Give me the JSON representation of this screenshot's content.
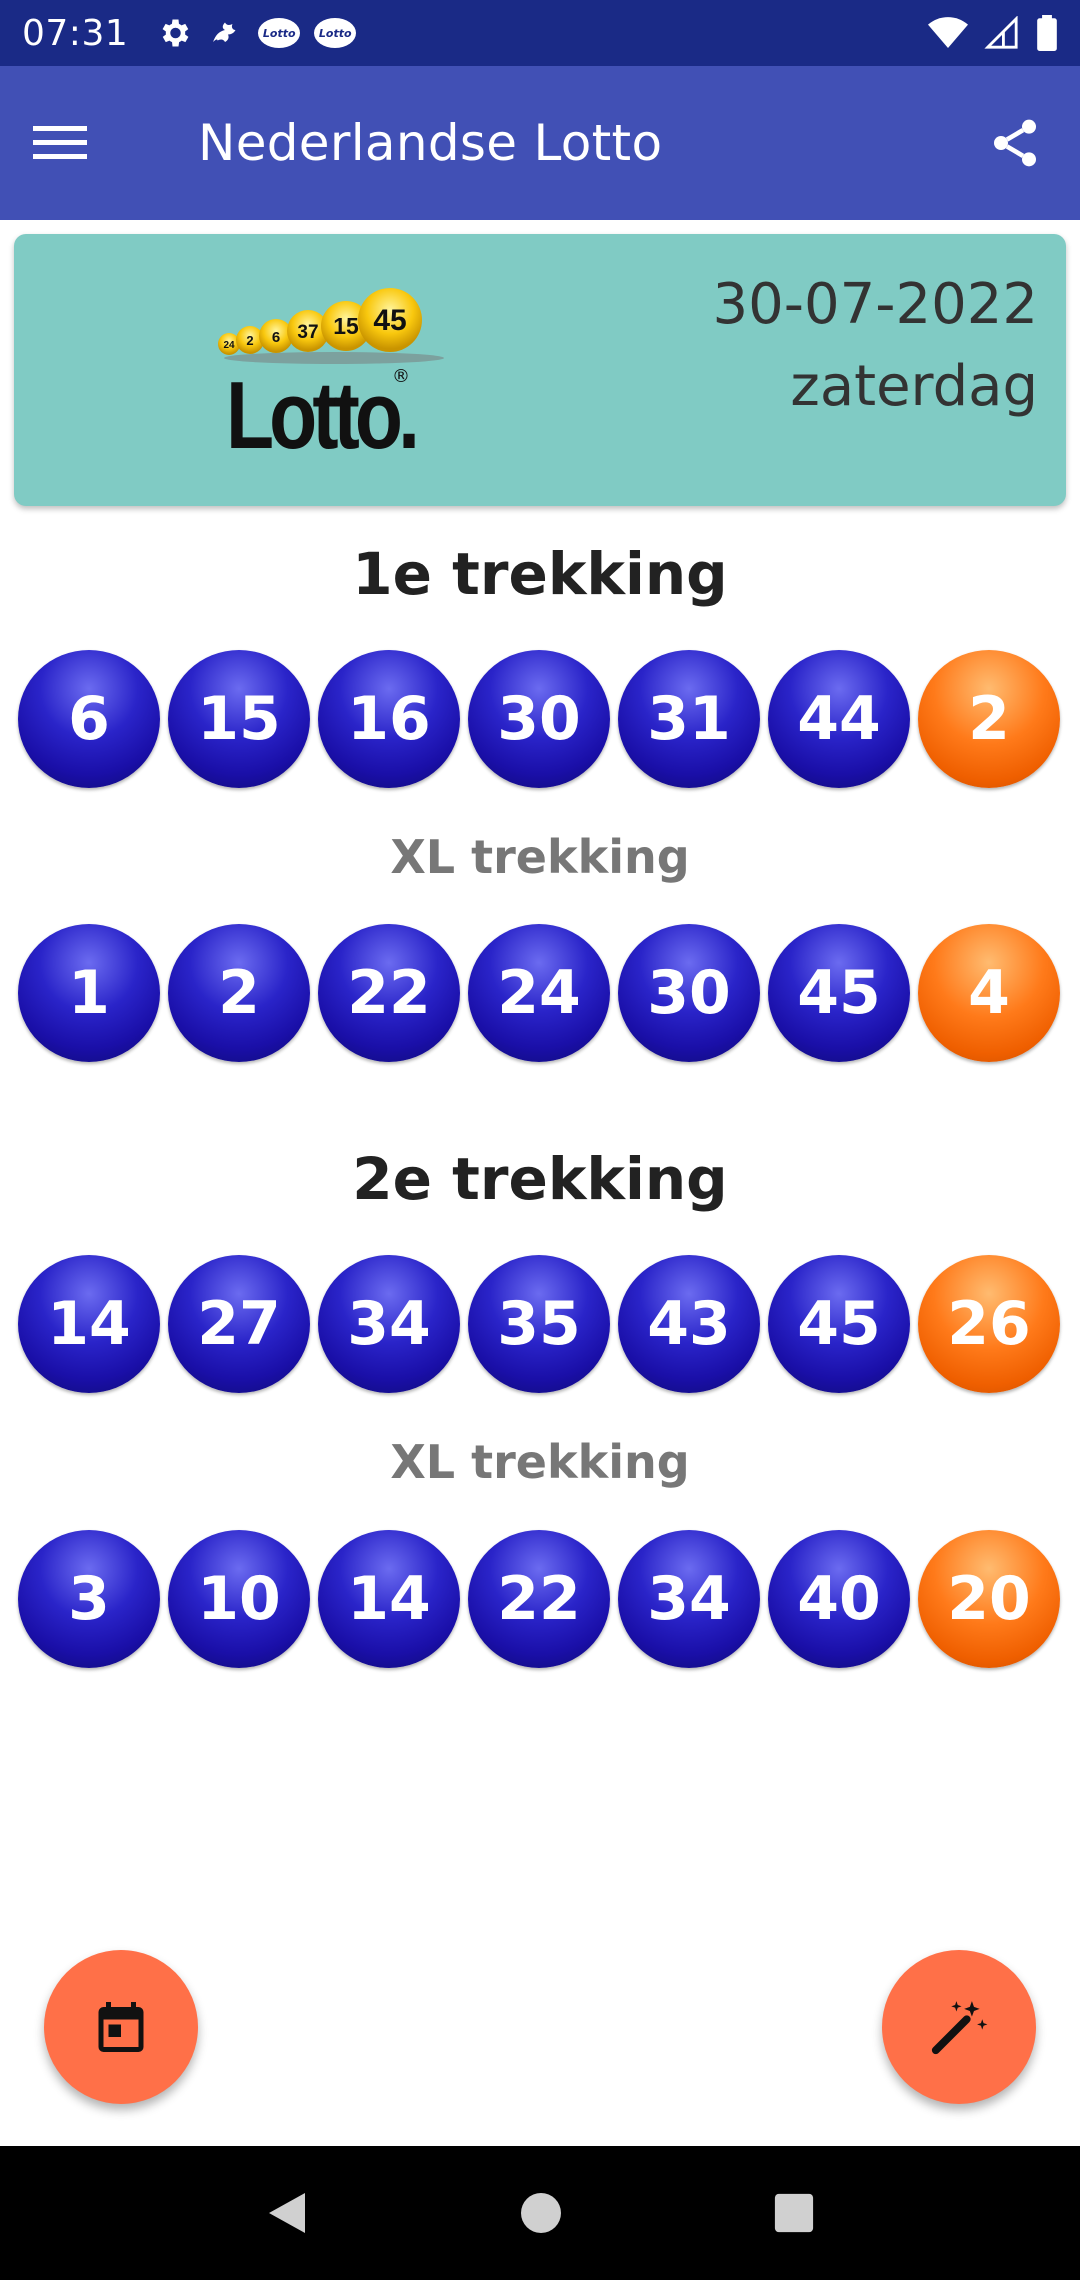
{
  "status_bar": {
    "time": "07:31",
    "icons": [
      "gear-icon",
      "dragon-icon",
      "lotto-icon",
      "lotto-icon",
      "wifi-icon",
      "signal-icon",
      "battery-icon"
    ],
    "mini_lotto_label": "Lotto"
  },
  "app_bar": {
    "title": "Nederlandse Lotto",
    "menu_icon": "menu-icon",
    "share_icon": "share-icon",
    "color": "#4150b5"
  },
  "header": {
    "logo_text": "Lotto.",
    "logo_reg": "®",
    "logo_balls": [
      "24",
      "2",
      "6",
      "37",
      "15",
      "45"
    ],
    "date": "30-07-2022",
    "day": "zaterdag",
    "background": "#80cbc4"
  },
  "draws": [
    {
      "title": "1e trekking",
      "main": {
        "numbers": [
          "6",
          "15",
          "16",
          "30",
          "31",
          "44"
        ],
        "bonus": "2"
      },
      "xl_title": "XL trekking",
      "xl": {
        "numbers": [
          "1",
          "2",
          "22",
          "24",
          "30",
          "45"
        ],
        "bonus": "4"
      }
    },
    {
      "title": "2e trekking",
      "main": {
        "numbers": [
          "14",
          "27",
          "34",
          "35",
          "43",
          "45"
        ],
        "bonus": "26"
      },
      "xl_title": "XL trekking",
      "xl": {
        "numbers": [
          "3",
          "10",
          "14",
          "22",
          "34",
          "40"
        ],
        "bonus": "20"
      }
    }
  ],
  "colors": {
    "ball_blue": "#1a0fa8",
    "ball_orange": "#ff7a1a",
    "fab": "#ff7048"
  },
  "fabs": {
    "left_icon": "calendar-icon",
    "right_icon": "magic-wand-icon"
  },
  "nav": {
    "back_icon": "back-icon",
    "home_icon": "home-icon",
    "recents_icon": "recents-icon"
  }
}
